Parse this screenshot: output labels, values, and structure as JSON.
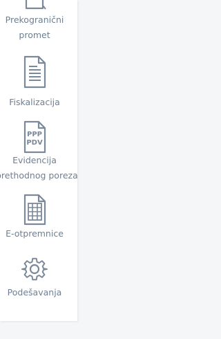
{
  "colors": {
    "panel_background": "#ffffff",
    "page_background": "#f5f6f8",
    "icon_stroke": "#7a8899",
    "label_text": "#6e7f92"
  },
  "sidebar": {
    "items": [
      {
        "label_line1": "Prekogranični",
        "label_line2": "promet",
        "icon": "document-transfer-icon"
      },
      {
        "label": "Fiskalizacija",
        "icon": "document-text-icon"
      },
      {
        "label_line1": "Evidencija",
        "label_line2": "prethodnog poreza",
        "icon": "ppp-pdv-document-icon",
        "icon_text_top": "PPP",
        "icon_text_bottom": "PDV"
      },
      {
        "label": "E-otpremnice",
        "icon": "spreadsheet-document-icon"
      },
      {
        "label": "Podešavanja",
        "icon": "gear-icon"
      }
    ]
  }
}
